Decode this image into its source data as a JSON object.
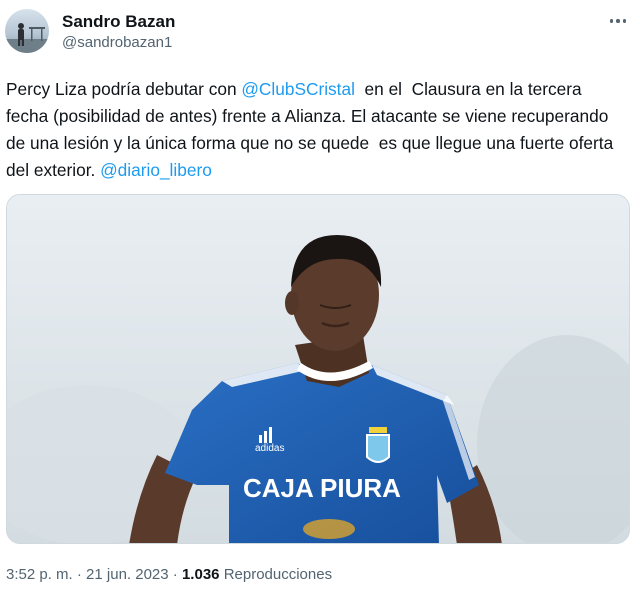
{
  "tweet": {
    "author": {
      "display_name": "Sandro Bazan",
      "handle": "@sandrobazan1"
    },
    "text_segments": [
      {
        "type": "text",
        "value": "Percy Liza podría debutar con "
      },
      {
        "type": "mention",
        "value": "@ClubSCristal"
      },
      {
        "type": "text",
        "value": "  en el  Clausura en la tercera fecha (posibilidad de antes) frente a Alianza. El atacante se viene recuperando de una lesión y la única forma que no se quede  es que llegue una fuerte oferta del exterior. "
      },
      {
        "type": "mention",
        "value": "@diario_libero"
      }
    ],
    "media": {
      "jersey_sponsor": "CAJA PIURA",
      "jersey_brand": "adidas"
    },
    "meta": {
      "time": "3:52 p. m.",
      "separator": " · ",
      "date": "21 jun. 2023",
      "views_count": "1.036",
      "views_label": "Reproducciones"
    }
  },
  "icons": {
    "more": "more-horizontal-icon",
    "avatar": "profile-avatar"
  },
  "colors": {
    "link": "#1d9bf0",
    "text": "#0f1419",
    "secondary": "#536471",
    "jersey": "#1f62b8"
  }
}
